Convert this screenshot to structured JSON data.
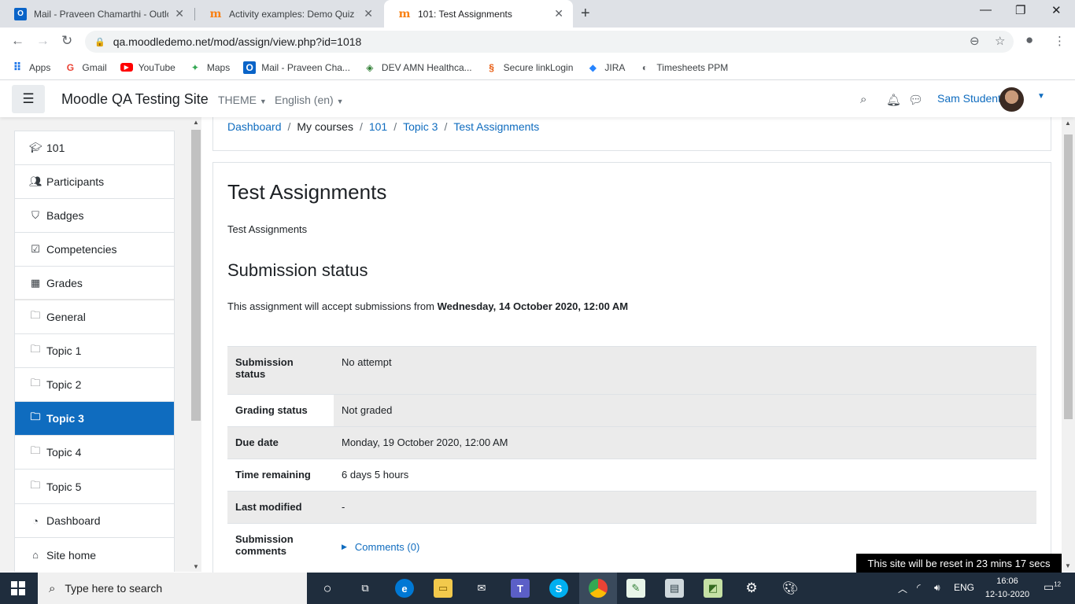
{
  "browser": {
    "tabs": [
      {
        "label": "Mail - Praveen Chamarthi - Outlo",
        "icon": "outlook-icon"
      },
      {
        "label": "Activity examples: Demo Quiz wi",
        "icon": "moodle-icon"
      },
      {
        "label": "101: Test Assignments",
        "icon": "moodle-icon",
        "active": true
      }
    ],
    "url": "qa.moodledemo.net/mod/assign/view.php?id=1018",
    "bookmarks": [
      {
        "label": "Apps"
      },
      {
        "label": "Gmail"
      },
      {
        "label": "YouTube"
      },
      {
        "label": "Maps"
      },
      {
        "label": "Mail - Praveen Cha..."
      },
      {
        "label": "DEV AMN Healthca..."
      },
      {
        "label": "Secure linkLogin"
      },
      {
        "label": "JIRA"
      },
      {
        "label": "Timesheets PPM"
      }
    ]
  },
  "navbar": {
    "site_name": "Moodle QA Testing Site",
    "theme_label": "THEME",
    "language_label": "English (en)",
    "user_name": "Sam Student"
  },
  "drawer": {
    "course_items": [
      {
        "label": "101",
        "icon": "graduation-cap-icon"
      },
      {
        "label": "Participants",
        "icon": "users-icon"
      },
      {
        "label": "Badges",
        "icon": "shield-icon"
      },
      {
        "label": "Competencies",
        "icon": "check-square-icon"
      },
      {
        "label": "Grades",
        "icon": "table-icon"
      },
      {
        "label": "General",
        "icon": "folder-icon"
      },
      {
        "label": "Topic 1",
        "icon": "folder-icon"
      },
      {
        "label": "Topic 2",
        "icon": "folder-icon"
      },
      {
        "label": "Topic 3",
        "icon": "folder-icon",
        "active": true
      },
      {
        "label": "Topic 4",
        "icon": "folder-icon"
      },
      {
        "label": "Topic 5",
        "icon": "folder-icon"
      }
    ],
    "site_items": [
      {
        "label": "Dashboard",
        "icon": "tachometer-icon"
      },
      {
        "label": "Site home",
        "icon": "home-icon"
      }
    ]
  },
  "breadcrumb": [
    {
      "label": "Dashboard",
      "link": true
    },
    {
      "label": "My courses",
      "link": false
    },
    {
      "label": "101",
      "link": true
    },
    {
      "label": "Topic 3",
      "link": true
    },
    {
      "label": "Test Assignments",
      "link": true
    }
  ],
  "main": {
    "title": "Test Assignments",
    "intro": "Test Assignments",
    "submission_heading": "Submission status",
    "availability_prefix": "This assignment will accept submissions from",
    "availability_date": "Wednesday, 14 October 2020, 12:00 AM",
    "status_rows": [
      {
        "label": "Submission status",
        "value": "No attempt"
      },
      {
        "label": "Grading status",
        "value": "Not graded"
      },
      {
        "label": "Due date",
        "value": "Monday, 19 October 2020, 12:00 AM"
      },
      {
        "label": "Time remaining",
        "value": "6 days 5 hours"
      },
      {
        "label": "Last modified",
        "value": "-"
      },
      {
        "label": "Submission comments",
        "value": "Comments (0)"
      }
    ]
  },
  "reset_notice": "This site will be reset in 23 mins 17 secs",
  "taskbar": {
    "search_placeholder": "Type here to search",
    "language": "ENG",
    "time": "16:06",
    "date": "12-10-2020",
    "notification_count": "12"
  },
  "colors": {
    "brand_blue": "#0f6cbf",
    "taskbar": "#1f2d3d"
  }
}
